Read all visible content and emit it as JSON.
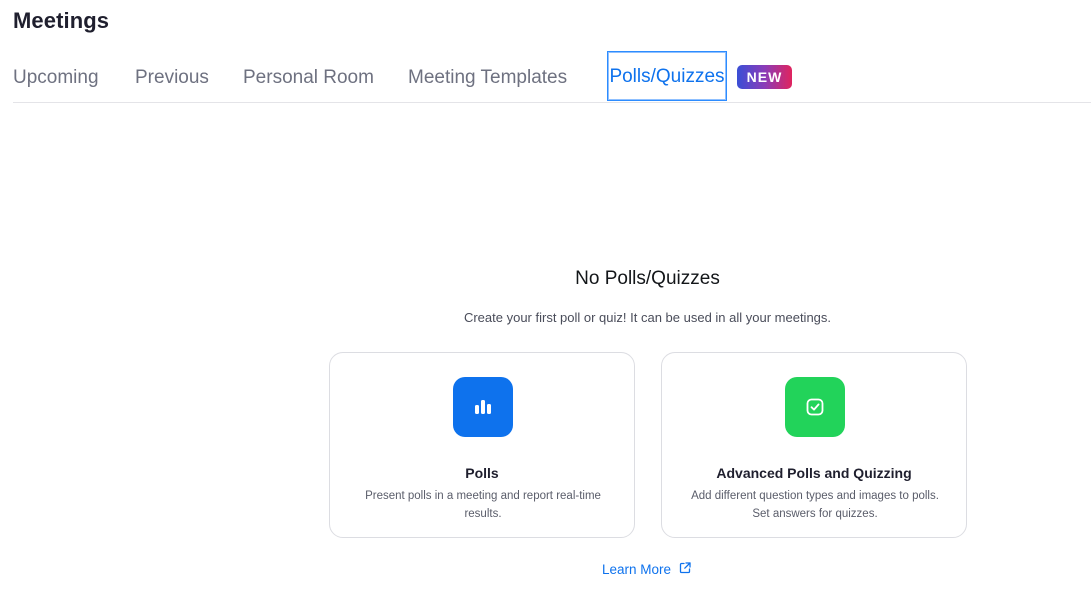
{
  "page": {
    "title": "Meetings"
  },
  "tabs": [
    {
      "label": "Upcoming",
      "active": false
    },
    {
      "label": "Previous",
      "active": false
    },
    {
      "label": "Personal Room",
      "active": false
    },
    {
      "label": "Meeting Templates",
      "active": false
    },
    {
      "label": "Polls/Quizzes",
      "active": true
    }
  ],
  "badge": {
    "label": "NEW"
  },
  "empty_state": {
    "title": "No Polls/Quizzes",
    "subtitle": "Create your first poll or quiz! It can be used in all your meetings."
  },
  "cards": [
    {
      "title": "Polls",
      "description": "Present polls in a meeting and report real-time results.",
      "icon": "bar-chart-icon",
      "color": "#0e72ed"
    },
    {
      "title": "Advanced Polls and Quizzing",
      "description": "Add different question types and images to polls. Set answers for quizzes.",
      "icon": "checkbox-icon",
      "color": "#22d35a"
    }
  ],
  "learn_more": {
    "label": "Learn More",
    "icon": "external-link-icon"
  },
  "colors": {
    "accent": "#0e72ed",
    "tab_inactive": "#6e7180"
  }
}
